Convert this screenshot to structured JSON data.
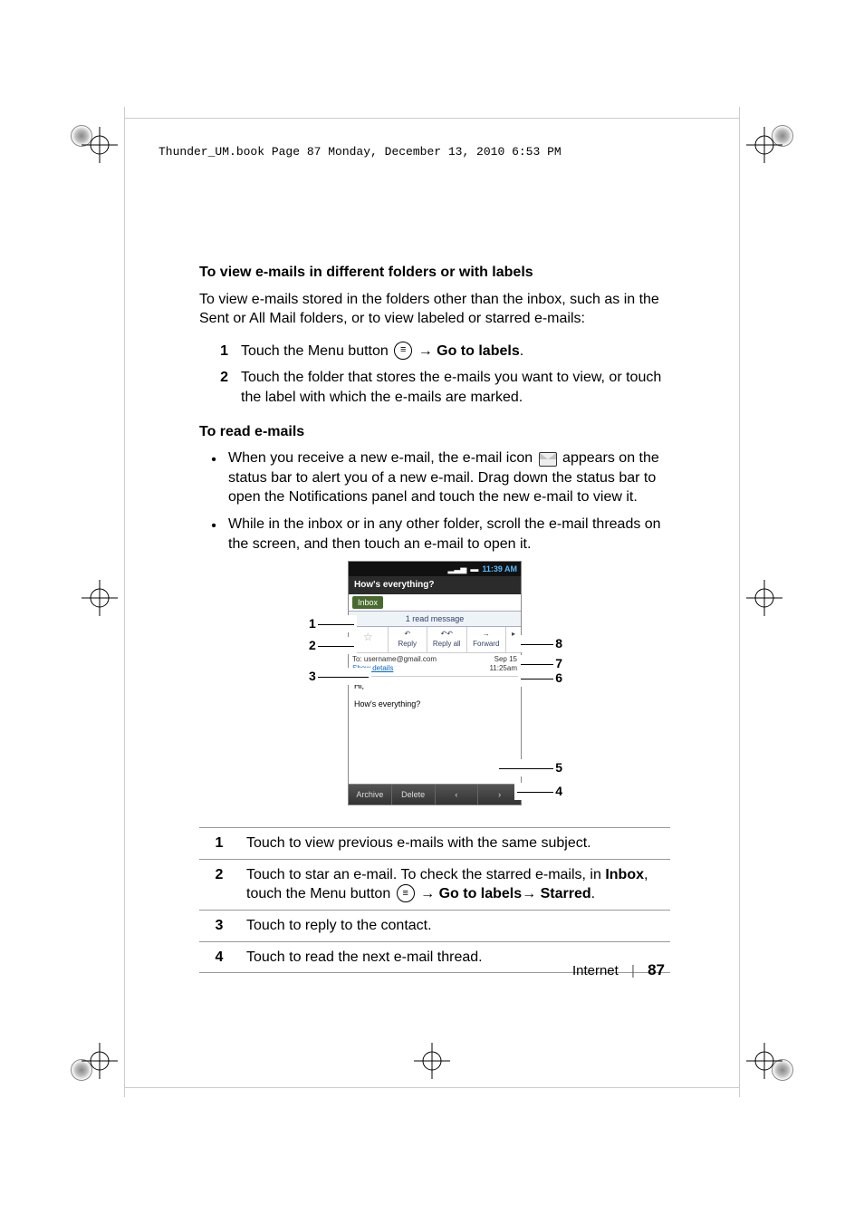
{
  "book_header": "Thunder_UM.book  Page 87  Monday, December 13, 2010  6:53 PM",
  "section1": {
    "title": "To view e-mails in different folders or with labels",
    "intro": "To view e-mails stored in the folders other than the inbox, such as in the Sent or All Mail folders, or to view labeled or starred e-mails:",
    "steps": [
      {
        "n": "1",
        "pre": "Touch the Menu button ",
        "mid": "→ ",
        "bold": "Go to labels",
        "post": "."
      },
      {
        "n": "2",
        "text": "Touch the folder that stores the e-mails you want to view, or touch the label with which the e-mails are marked."
      }
    ]
  },
  "section2": {
    "title": "To read e-mails",
    "bullets": [
      "When you receive a new e-mail, the e-mail icon   appears on the status bar to alert you of a new e-mail. Drag down the status bar to open the Notifications panel and touch the new e-mail to view it.",
      "While in the inbox or in any other folder, scroll the e-mail threads on the screen, and then touch an e-mail to open it."
    ]
  },
  "phone": {
    "time": "11:39 AM",
    "subject": "How's everything?",
    "label": "Inbox",
    "readmsg": "1 read message",
    "actions": {
      "reply": "Reply",
      "replyall": "Reply all",
      "forward": "Forward"
    },
    "to_line_left": "To: username@gmail.com",
    "show_details": "Show details",
    "date": "Sep 15",
    "time2": "11:25am",
    "body_hi": "Hi,",
    "body_q": "How's everything?",
    "bottom": {
      "archive": "Archive",
      "delete": "Delete",
      "prev": "‹",
      "next": "›"
    }
  },
  "callouts": {
    "1": "1",
    "2": "2",
    "3": "3",
    "4": "4",
    "5": "5",
    "6": "6",
    "7": "7",
    "8": "8"
  },
  "legend": [
    {
      "n": "1",
      "text": "Touch to view previous e-mails with the same subject."
    },
    {
      "n": "2",
      "pre": "Touch to star an e-mail. To check the starred e-mails, in ",
      "b1": "Inbox",
      "mid": ", touch the Menu button ",
      "arrow1": "→ ",
      "b2": "Go to labels",
      "arrow2": "→ ",
      "b3": "Starred",
      "post": "."
    },
    {
      "n": "3",
      "text": "Touch to reply to the contact."
    },
    {
      "n": "4",
      "text": "Touch to read the next e-mail thread."
    }
  ],
  "footer": {
    "section": "Internet",
    "page": "87"
  }
}
